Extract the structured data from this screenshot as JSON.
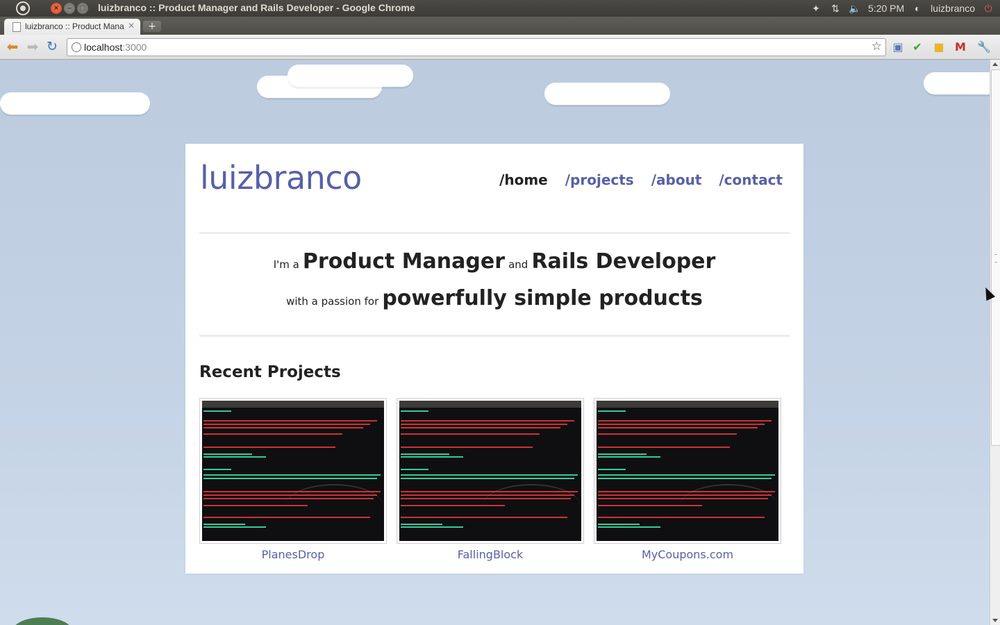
{
  "os_panel": {
    "window_title": "luizbranco :: Product Manager and Rails Developer - Google Chrome",
    "clock": "5:20 PM",
    "user": "luizbranco",
    "tray_icons": [
      "dropbox-icon",
      "network-icon",
      "volume-icon",
      "user-icon",
      "power-icon"
    ]
  },
  "browser": {
    "tab_title": "luizbranco :: Product Mana",
    "url_host": "localhost",
    "url_port": ":3000"
  },
  "site": {
    "logo": "luizbranco",
    "nav": [
      {
        "label": "/home",
        "active": true
      },
      {
        "label": "/projects",
        "active": false
      },
      {
        "label": "/about",
        "active": false
      },
      {
        "label": "/contact",
        "active": false
      }
    ],
    "tagline": {
      "l1_pre": "I'm a",
      "l1_role1": "Product Manager",
      "l1_and": "and",
      "l1_role2": "Rails Developer",
      "l2_pre": "with a passion for",
      "l2_big": "powerfully simple products"
    },
    "recent_title": "Recent Projects",
    "projects": [
      {
        "name": "PlanesDrop"
      },
      {
        "name": "FallingBlock"
      },
      {
        "name": "MyCoupons.com"
      }
    ]
  },
  "colors": {
    "brand": "#5760a8",
    "sky": "#bccbde",
    "text": "#222222"
  }
}
